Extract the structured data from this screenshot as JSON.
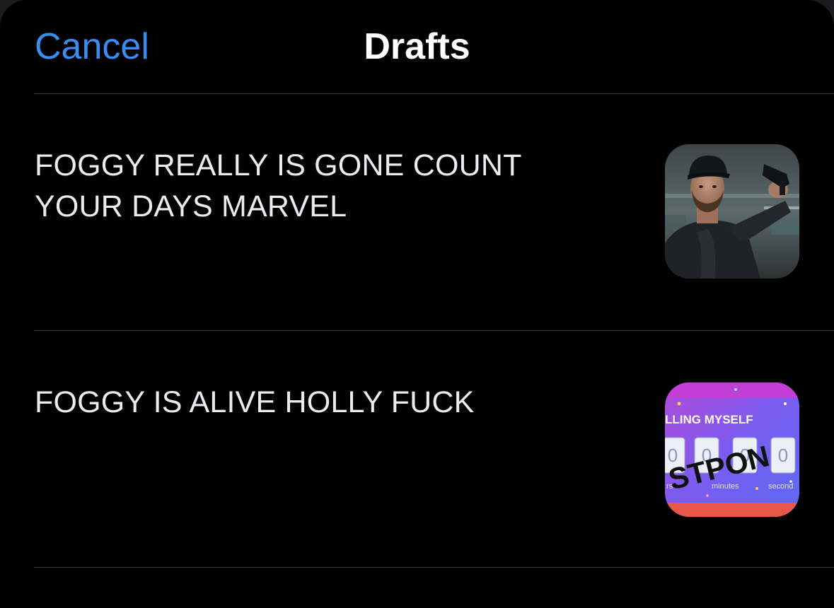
{
  "nav": {
    "cancel_label": "Cancel",
    "title": "Drafts"
  },
  "drafts": [
    {
      "text": "FOGGY REALLY IS GONE COUNT YOUR DAYS MARVEL",
      "thumbnail": "photo-man-with-cap-aiming-pistol"
    },
    {
      "text": "FOGGY IS ALIVE HOLLY FUCK",
      "thumbnail": "countdown-timer-meme",
      "thumbnail_text": {
        "banner": "LLING MYSELF",
        "stamp": "STPON",
        "digits": [
          "0",
          "0",
          "0",
          "0"
        ],
        "units": [
          "rs",
          "minutes",
          "second"
        ]
      }
    }
  ],
  "colors": {
    "background": "#000000",
    "accent": "#3b8cf0",
    "separator": "#38383a",
    "text": "#ebebf0"
  }
}
